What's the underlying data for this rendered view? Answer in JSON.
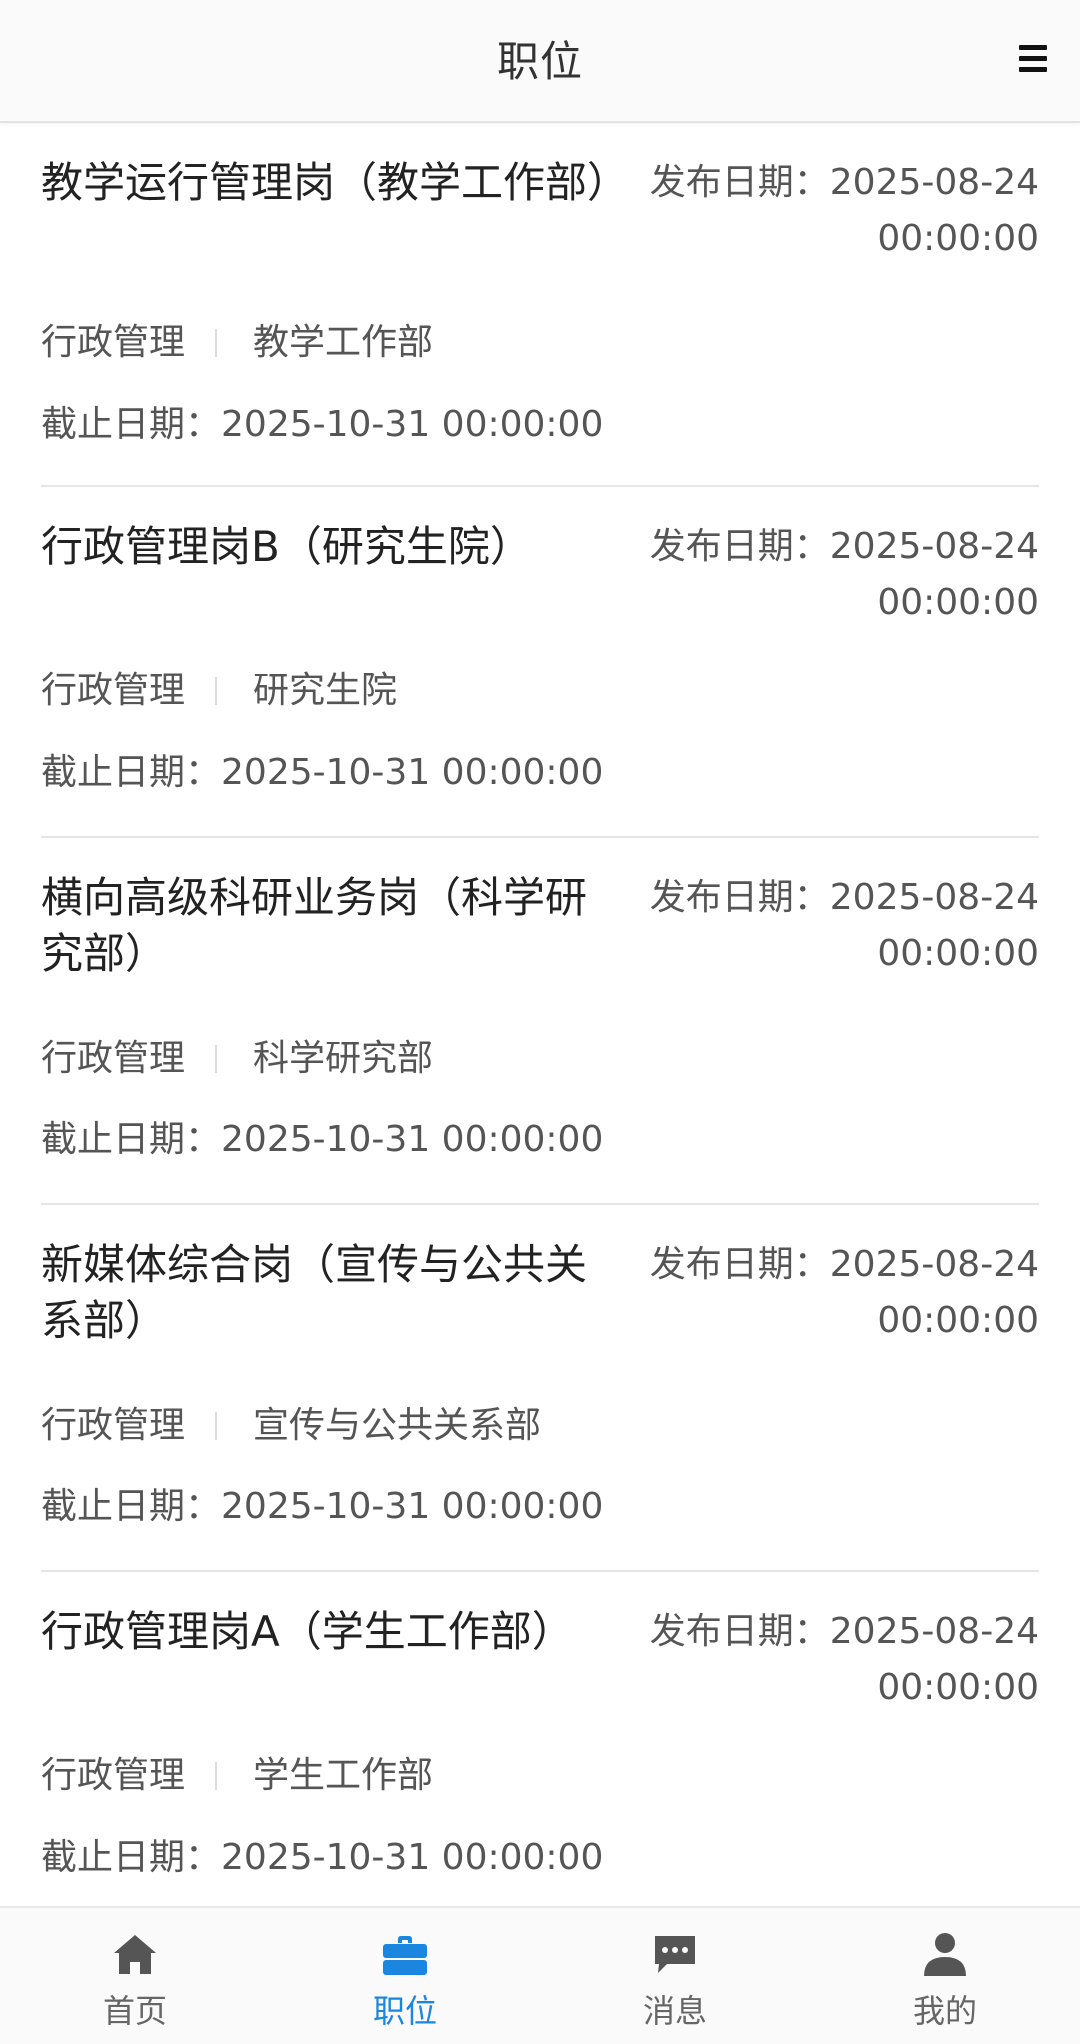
{
  "header": {
    "title": "职位",
    "menu_icon": "hamburger-menu-icon"
  },
  "jobs": [
    {
      "name": "教学运行管理岗（教学工作部）",
      "pub_label": "发布日期：",
      "pub_date": "2025-08-24",
      "pub_time": "00:00:00",
      "category": "行政管理",
      "department": "教学工作部",
      "deadline_label": "截止日期：",
      "deadline": "2025-10-31 00:00:00"
    },
    {
      "name": "行政管理岗B（研究生院）",
      "pub_label": "发布日期：",
      "pub_date": "2025-08-24",
      "pub_time": "00:00:00",
      "category": "行政管理",
      "department": "研究生院",
      "deadline_label": "截止日期：",
      "deadline": "2025-10-31 00:00:00"
    },
    {
      "name": "横向高级科研业务岗（科学研究部）",
      "pub_label": "发布日期：",
      "pub_date": "2025-08-24",
      "pub_time": "00:00:00",
      "category": "行政管理",
      "department": "科学研究部",
      "deadline_label": "截止日期：",
      "deadline": "2025-10-31 00:00:00"
    },
    {
      "name": "新媒体综合岗（宣传与公共关系部）",
      "pub_label": "发布日期：",
      "pub_date": "2025-08-24",
      "pub_time": "00:00:00",
      "category": "行政管理",
      "department": "宣传与公共关系部",
      "deadline_label": "截止日期：",
      "deadline": "2025-10-31 00:00:00"
    },
    {
      "name": "行政管理岗A（学生工作部）",
      "pub_label": "发布日期：",
      "pub_date": "2025-08-24",
      "pub_time": "00:00:00",
      "category": "行政管理",
      "department": "学生工作部",
      "deadline_label": "截止日期：",
      "deadline": "2025-10-31 00:00:00"
    }
  ],
  "tabbar": {
    "items": [
      {
        "label": "首页",
        "icon": "home-icon",
        "active": false
      },
      {
        "label": "职位",
        "icon": "briefcase-icon",
        "active": true
      },
      {
        "label": "消息",
        "icon": "chat-bubble-icon",
        "active": false
      },
      {
        "label": "我的",
        "icon": "user-icon",
        "active": false
      }
    ]
  },
  "colors": {
    "accent": "#1a86e0",
    "inactive_icon": "#555555",
    "text_primary": "#222222",
    "text_secondary": "#555555"
  }
}
